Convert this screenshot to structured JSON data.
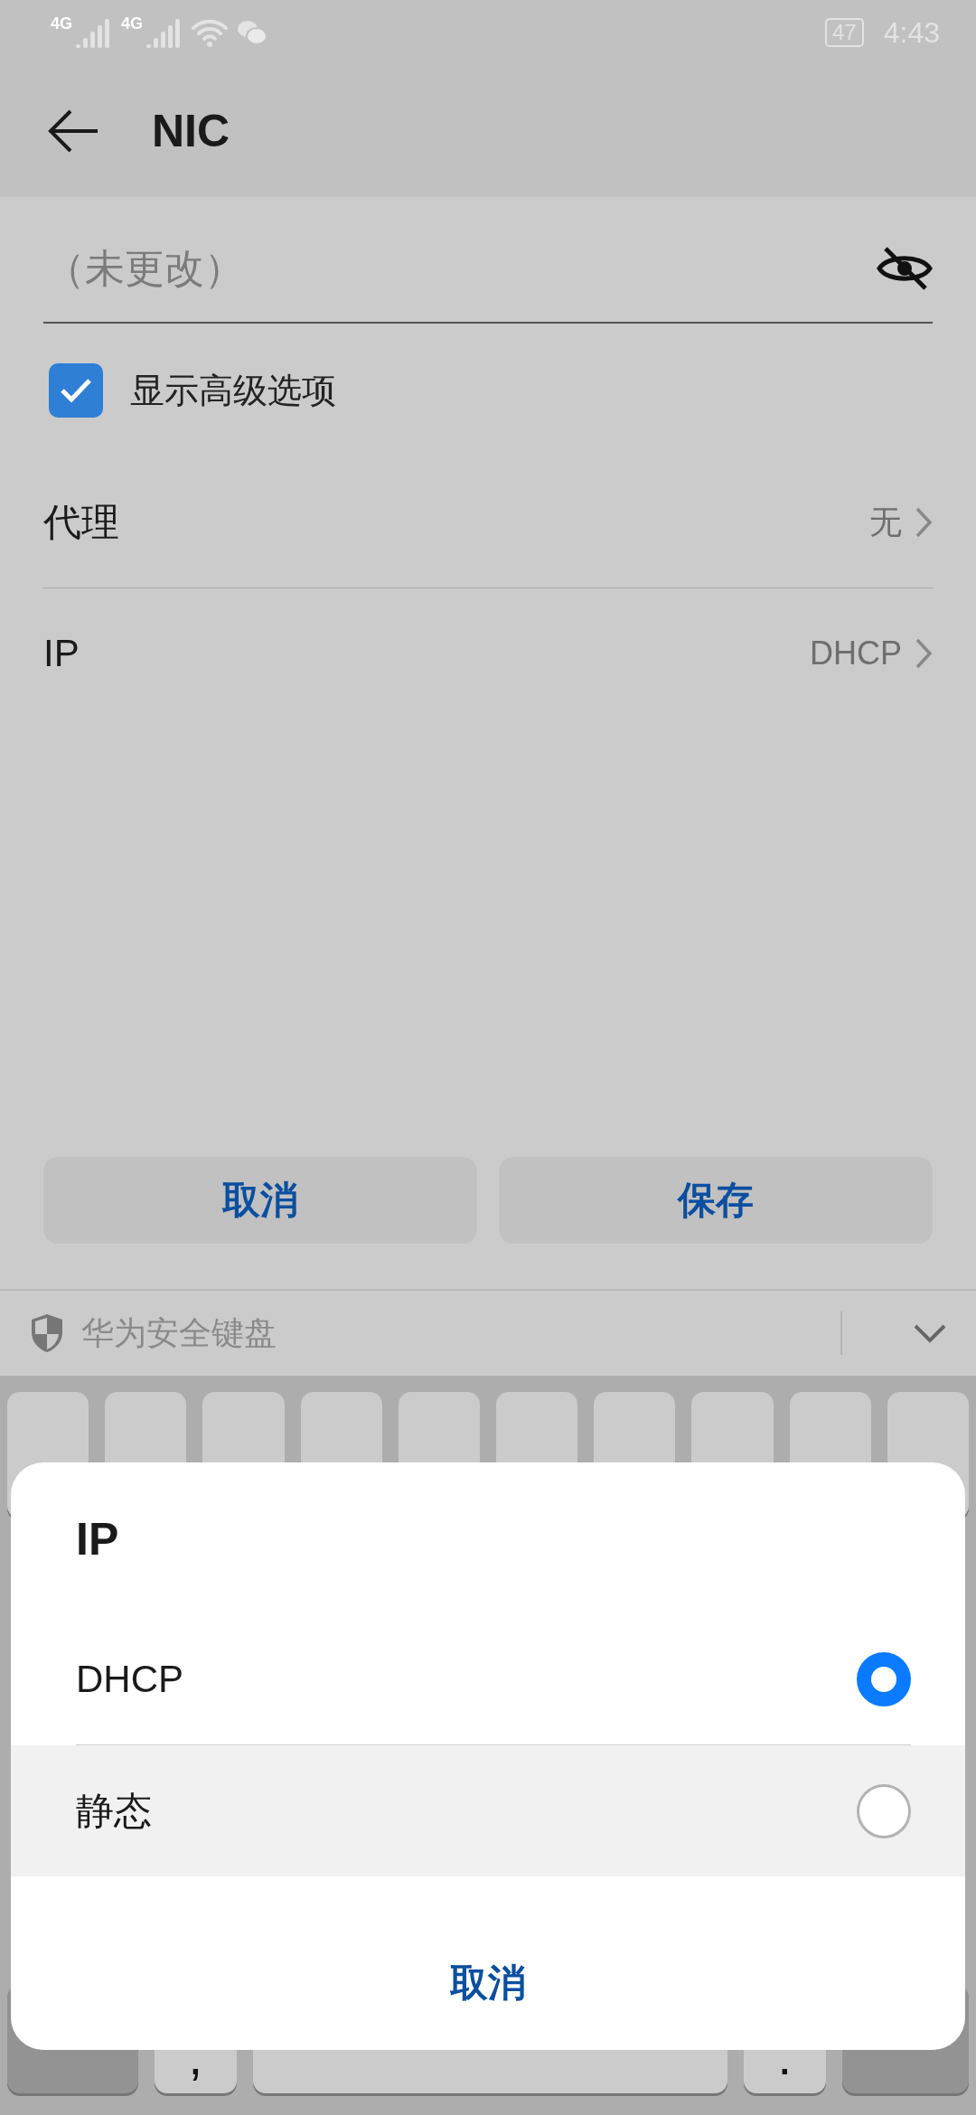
{
  "status_bar": {
    "network_1": "4G",
    "network_2": "4G",
    "battery": "47",
    "time": "4:43"
  },
  "header": {
    "title": "NIC"
  },
  "password_field": {
    "placeholder": "（未更改）",
    "visible": false
  },
  "advanced_checkbox": {
    "label": "显示高级选项",
    "checked": true
  },
  "settings": [
    {
      "label": "代理",
      "value": "无"
    },
    {
      "label": "IP",
      "value": "DHCP"
    }
  ],
  "buttons": [
    {
      "label": "取消"
    },
    {
      "label": "保存"
    }
  ],
  "keyboard": {
    "title": "华为安全键盘",
    "bottom_row": [
      {
        "kind": "mode"
      },
      {
        "kind": "char",
        "label": ","
      },
      {
        "kind": "space"
      },
      {
        "kind": "char",
        "label": "."
      },
      {
        "kind": "enter"
      }
    ]
  },
  "dialog": {
    "title": "IP",
    "options": [
      {
        "label": "DHCP",
        "selected": true,
        "highlighted": false
      },
      {
        "label": "静态",
        "selected": false,
        "highlighted": true
      }
    ],
    "cancel": "取消"
  }
}
